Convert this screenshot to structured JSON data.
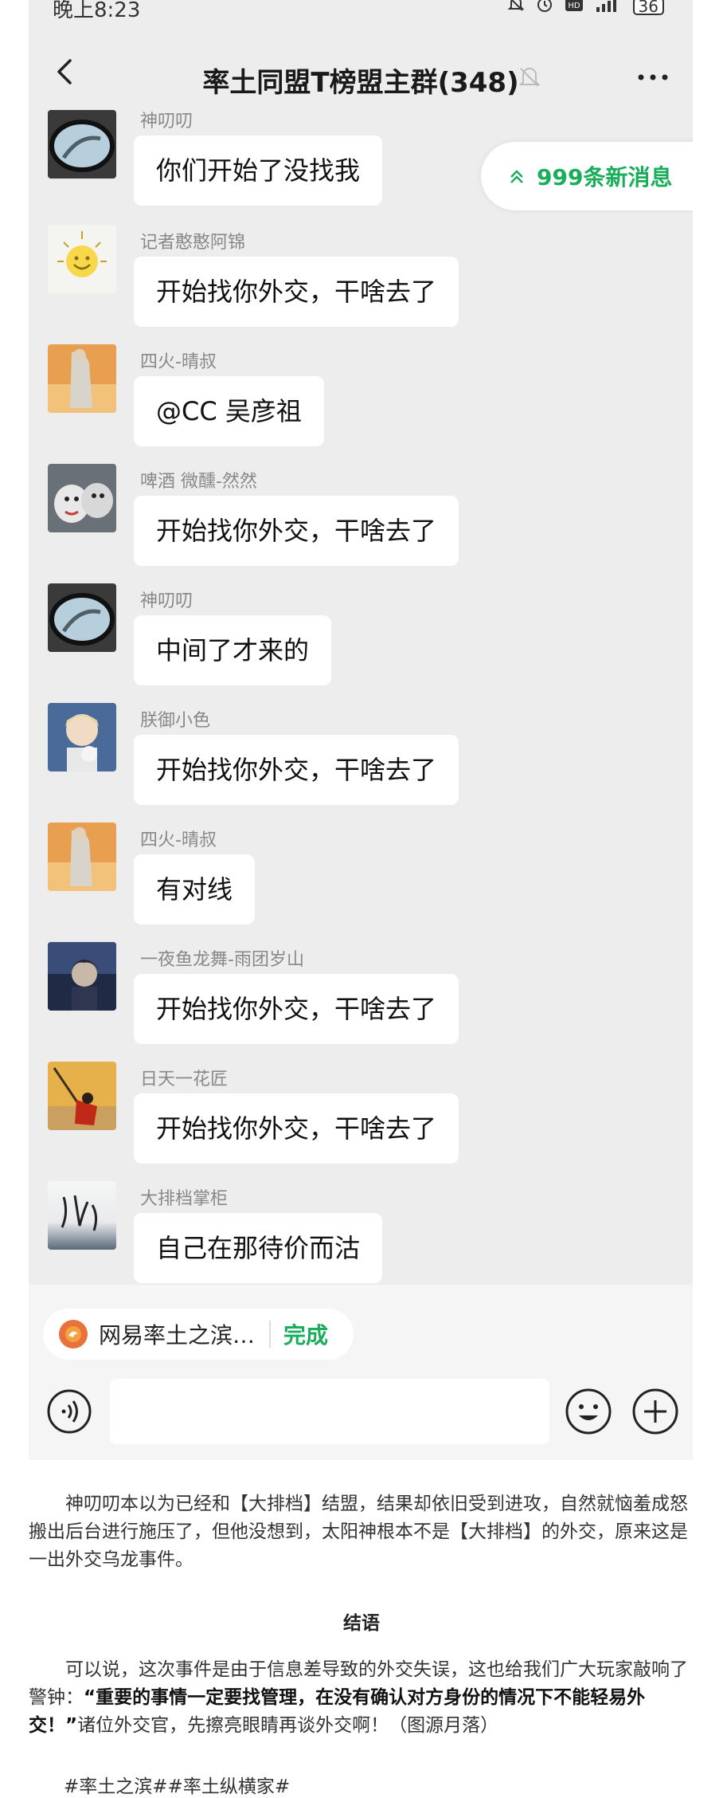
{
  "status_bar": {
    "time": "晚上8:23",
    "battery": "36",
    "icons": [
      "mute-bell-icon",
      "alarm-icon",
      "hd-icon",
      "signal-icon",
      "battery-icon"
    ]
  },
  "chat": {
    "title": "率土同盟T榜盟主群(348)",
    "new_messages": "999条新消息",
    "messages": [
      {
        "sender": "神叨叨",
        "text": "你们开始了没找我",
        "avatar": "mirror-avatar"
      },
      {
        "sender": "记者憨憨阿锦",
        "text": "开始找你外交，干啥去了",
        "avatar": "sun-avatar"
      },
      {
        "sender": "四火-晴叔",
        "text": "@CC 吴彦祖",
        "avatar": "figure-avatar"
      },
      {
        "sender": "啤酒 微醺-然然",
        "text": "开始找你外交，干啥去了",
        "avatar": "husky-avatar"
      },
      {
        "sender": "神叨叨",
        "text": "中间了才来的",
        "avatar": "mirror-avatar"
      },
      {
        "sender": "朕御小色",
        "text": "开始找你外交，干啥去了",
        "avatar": "anime-boy-avatar"
      },
      {
        "sender": "四火-晴叔",
        "text": "有对线",
        "avatar": "figure-avatar"
      },
      {
        "sender": "一夜鱼龙舞-雨团岁山",
        "text": "开始找你外交，干啥去了",
        "avatar": "night-avatar"
      },
      {
        "sender": "日天一花匠",
        "text": "开始找你外交，干啥去了",
        "avatar": "spear-avatar"
      },
      {
        "sender": "大排档掌柜",
        "text": "自己在那待价而沽",
        "avatar": "calligraphy-avatar"
      }
    ]
  },
  "input_bar": {
    "chip_label": "网易率土之滨…",
    "chip_done": "完成"
  },
  "article": {
    "p1": "神叨叨本以为已经和【大排档】结盟，结果却依旧受到进攻，自然就恼羞成怒搬出后台进行施压了，但他没想到，太阳神根本不是【大排档】的外交，原来这是一出外交乌龙事件。",
    "heading": "结语",
    "p2_before": "可以说，这次事件是由于信息差导致的外交失误，这也给我们广大玩家敲响了警钟：",
    "p2_bold": "“重要的事情一定要找管理，在没有确认对方身份的情况下不能轻易外交！”",
    "p2_after": "诸位外交官，先擦亮眼睛再谈外交啊！（图源月落）",
    "tags": "#率土之滨##率土纵横家#"
  }
}
